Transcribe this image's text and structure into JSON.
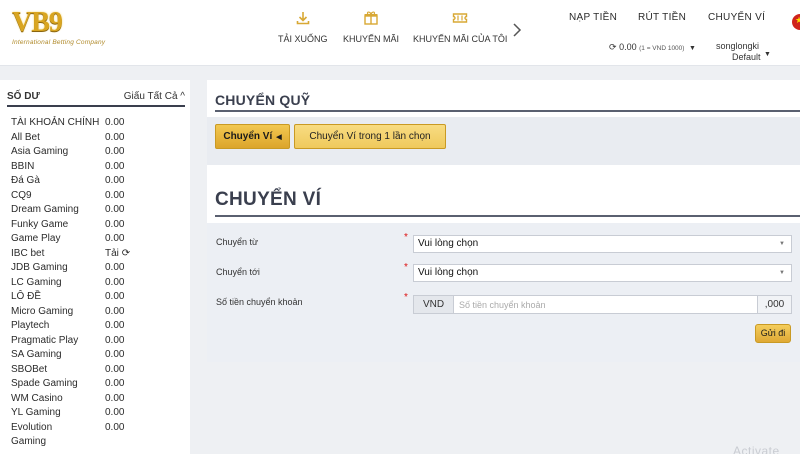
{
  "header": {
    "logo_text": "VB9",
    "logo_tagline": "International Betting Company",
    "nav": [
      {
        "label": "TẢI XUỐNG",
        "icon": "download-icon"
      },
      {
        "label": "KHUYẾN MÃI",
        "icon": "gift-icon"
      },
      {
        "label": "KHUYẾN MÃI CỦA TÔI",
        "icon": "ticket-icon"
      }
    ],
    "top_links": {
      "deposit": "NẠP TIỀN",
      "withdraw": "RÚT TIỀN",
      "transfer": "CHUYỂN VÍ"
    },
    "balance": {
      "amount": "0.00",
      "rate": "(1 = VND 1000)"
    },
    "user": {
      "name": "songlongki",
      "plan": "Default"
    }
  },
  "sidebar": {
    "title": "SỐ DƯ",
    "hide_all": "Giấu Tất Cả",
    "items": [
      {
        "name": "TÀI KHOẢN CHÍNH",
        "value": "0.00"
      },
      {
        "name": "All Bet",
        "value": "0.00"
      },
      {
        "name": "Asia Gaming",
        "value": "0.00"
      },
      {
        "name": "BBIN",
        "value": "0.00"
      },
      {
        "name": "Đá Gà",
        "value": "0.00"
      },
      {
        "name": "CQ9",
        "value": "0.00"
      },
      {
        "name": "Dream Gaming",
        "value": "0.00"
      },
      {
        "name": "Funky Game",
        "value": "0.00"
      },
      {
        "name": "Game Play",
        "value": "0.00"
      },
      {
        "name": "IBC bet",
        "value": "Tải"
      },
      {
        "name": "JDB Gaming",
        "value": "0.00"
      },
      {
        "name": "LC Gaming",
        "value": "0.00"
      },
      {
        "name": "LÔ ĐỀ",
        "value": "0.00"
      },
      {
        "name": "Micro Gaming",
        "value": "0.00"
      },
      {
        "name": "Playtech",
        "value": "0.00"
      },
      {
        "name": "Pragmatic Play",
        "value": "0.00"
      },
      {
        "name": "SA Gaming",
        "value": "0.00"
      },
      {
        "name": "SBOBet",
        "value": "0.00"
      },
      {
        "name": "Spade Gaming",
        "value": "0.00"
      },
      {
        "name": "WM Casino",
        "value": "0.00"
      },
      {
        "name": "YL Gaming",
        "value": "0.00"
      },
      {
        "name": "Evolution",
        "value": "0.00"
      },
      {
        "name": "Gaming",
        "value": ""
      }
    ]
  },
  "transfer_panel": {
    "title": "CHUYỂN QUỸ",
    "tabs": [
      {
        "label": "Chuyển Ví"
      },
      {
        "label": "Chuyển Ví trong 1 lần chọn"
      }
    ]
  },
  "wallet_form": {
    "title": "CHUYỂN VÍ",
    "from_label": "Chuyển từ",
    "from_value": "Vui lòng chọn",
    "to_label": "Chuyển tới",
    "to_value": "Vui lòng chọn",
    "amount_label": "Số tiền chuyển khoản",
    "currency": "VND",
    "amount_placeholder": "Số tiền chuyển khoản",
    "amount_suffix": ",000",
    "submit_label": "Gửi đi"
  },
  "watermark": "Activate"
}
